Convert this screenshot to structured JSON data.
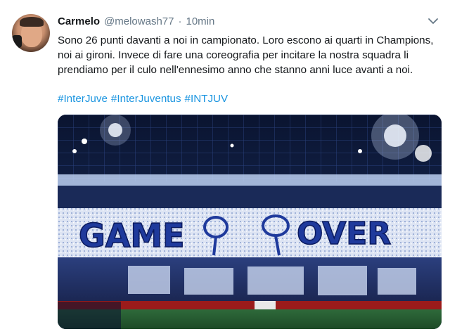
{
  "tweet": {
    "display_name": "Carmelo",
    "handle": "@melowash77",
    "separator": "·",
    "timestamp": "10min",
    "text": "Sono 26 punti davanti a noi in campionato. Loro escono ai quarti in Champions, noi ai gironi. Invece di fare una coreografia per incitare la nostra squadra li prendiamo per il culo nell'ennesimo anno che stanno anni luce avanti a noi.",
    "hashtags": [
      "#InterJuve",
      "#InterJuventus",
      "#INTJUV"
    ],
    "media": {
      "banner_words": [
        "GAME",
        "OVER"
      ]
    }
  },
  "colors": {
    "link": "#1b95e0",
    "secondary_text": "#657786",
    "primary_text": "#14171a"
  },
  "icons": {
    "menu": "chevron-down-icon"
  }
}
